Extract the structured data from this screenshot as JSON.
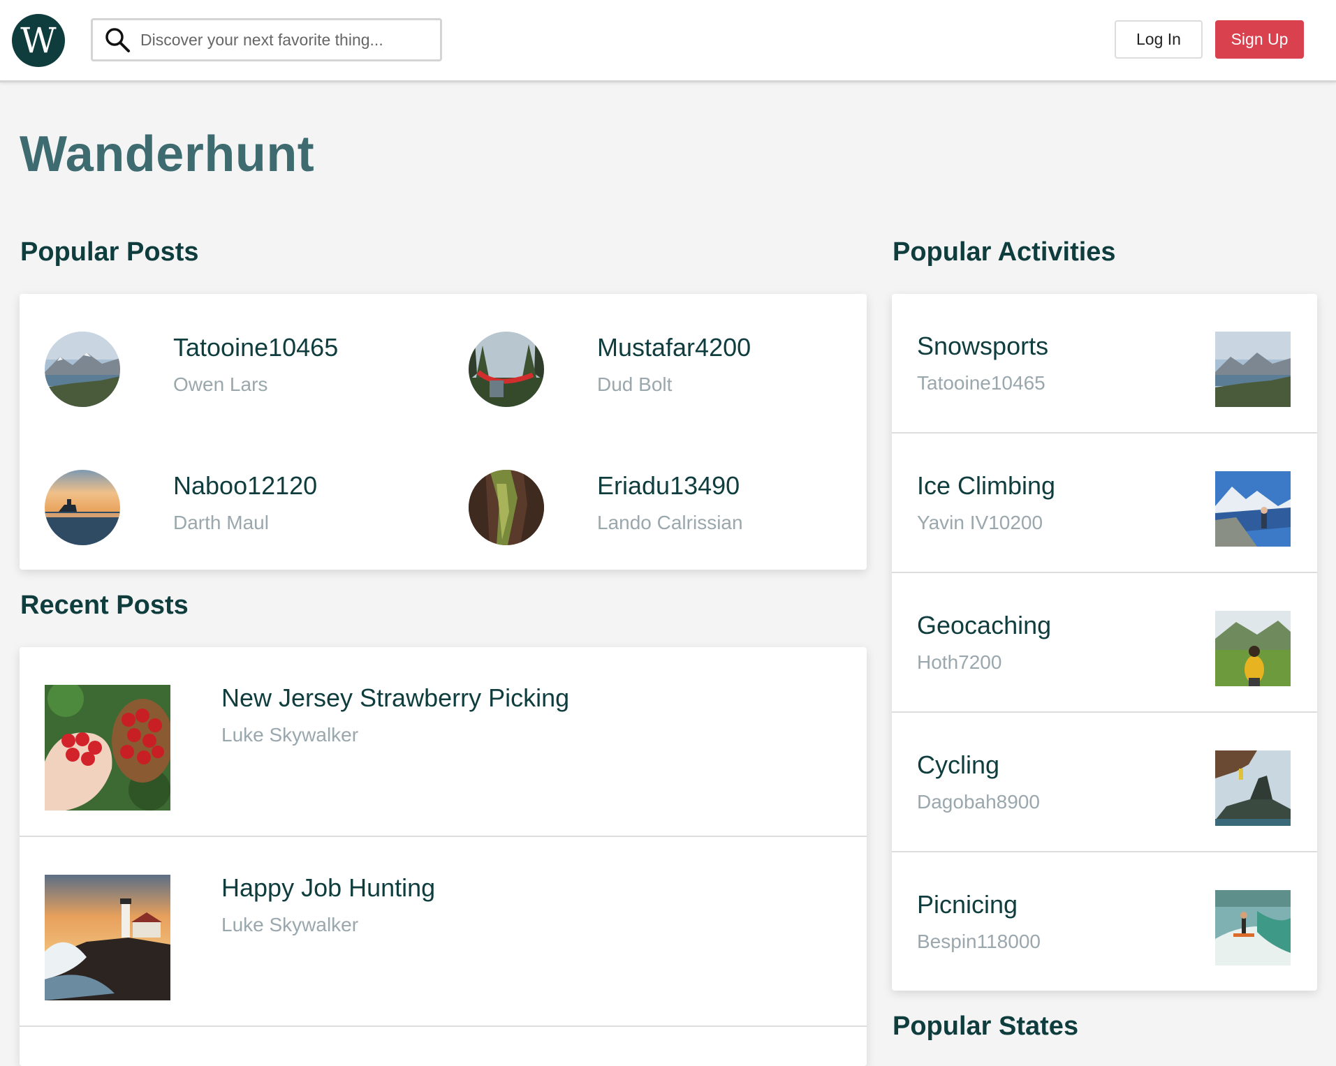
{
  "header": {
    "logo_letter": "W",
    "search_placeholder": "Discover your next favorite thing...",
    "login_label": "Log In",
    "signup_label": "Sign Up",
    "colors": {
      "brand": "#0f3d3e",
      "signup": "#d9414e"
    }
  },
  "site_title": "Wanderhunt",
  "popular_posts": {
    "heading": "Popular Posts",
    "items": [
      {
        "title": "Tatooine10465",
        "author": "Owen Lars",
        "image": "mountain-lake-photo"
      },
      {
        "title": "Mustafar4200",
        "author": "Dud Bolt",
        "image": "hammock-forest-photo"
      },
      {
        "title": "Naboo12120",
        "author": "Darth Maul",
        "image": "sunset-boat-photo"
      },
      {
        "title": "Eriadu13490",
        "author": "Lando Calrissian",
        "image": "mossy-canyon-photo"
      }
    ]
  },
  "recent_posts": {
    "heading": "Recent Posts",
    "items": [
      {
        "title": "New Jersey Strawberry Picking",
        "author": "Luke Skywalker",
        "image": "strawberries-photo"
      },
      {
        "title": "Happy Job Hunting",
        "author": "Luke Skywalker",
        "image": "lighthouse-waves-photo"
      }
    ]
  },
  "popular_activities": {
    "heading": "Popular Activities",
    "items": [
      {
        "title": "Snowsports",
        "author": "Tatooine10465",
        "image": "mountain-lake-photo"
      },
      {
        "title": "Ice Climbing",
        "author": "Yavin IV10200",
        "image": "hiker-mountain-photo"
      },
      {
        "title": "Geocaching",
        "author": "Hoth7200",
        "image": "backpacker-valley-photo"
      },
      {
        "title": "Cycling",
        "author": "Dagobah8900",
        "image": "cliff-climber-photo"
      },
      {
        "title": "Picnicing",
        "author": "Bespin118000",
        "image": "wakesurfer-photo"
      }
    ]
  },
  "popular_states": {
    "heading": "Popular States"
  }
}
